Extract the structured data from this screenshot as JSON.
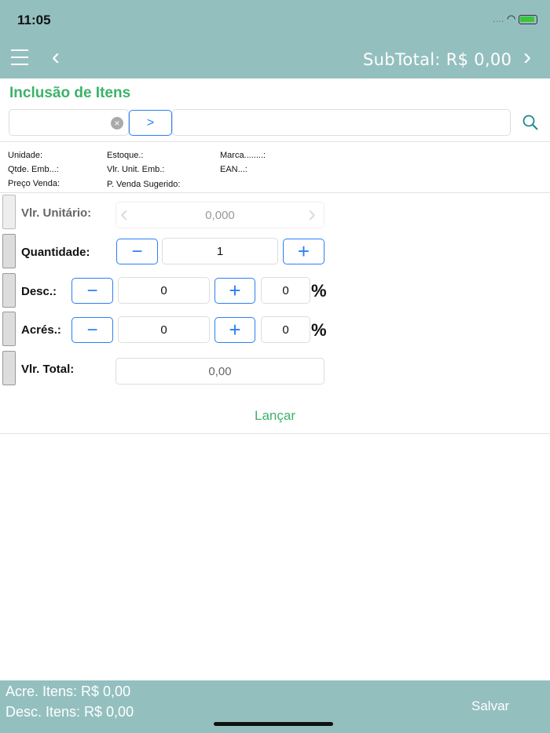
{
  "status": {
    "time": "11:05",
    "signal": "....",
    "wifi": "wifi-icon",
    "battery": "battery-icon"
  },
  "nav": {
    "subtotal": "SubTotal: R$ 0,00"
  },
  "page": {
    "title": "Inclusão de Itens",
    "go_label": ">",
    "code_value": "",
    "desc_value": ""
  },
  "info": {
    "unidade": "Unidade:",
    "estoque": "Estoque.:",
    "marca": "Marca........:",
    "qtde_emb": "Qtde. Emb...:",
    "vlr_unit_emb": "Vlr. Unit. Emb.:",
    "ean": "EAN...:",
    "preco_venda": "Preço Venda:",
    "p_venda_sugerido": "P. Venda Sugerido:"
  },
  "form": {
    "vlr_unitario_label": "Vlr. Unitário:",
    "vlr_unitario": "0,000",
    "quantidade_label": "Quantidade:",
    "quantidade": "1",
    "desc_label": "Desc.:",
    "desc_value": "0",
    "desc_pct": "0",
    "acres_label": "Acrés.:",
    "acres_value": "0",
    "acres_pct": "0",
    "pct_symbol": "%",
    "vlr_total_label": "Vlr. Total:",
    "vlr_total": "0,00",
    "minus": "−",
    "plus": "+"
  },
  "lancar": "Lançar",
  "footer": {
    "acre_itens": "Acre. Itens: R$ 0,00",
    "desc_itens": "Desc. Itens: R$ 0,00",
    "salvar": "Salvar"
  }
}
